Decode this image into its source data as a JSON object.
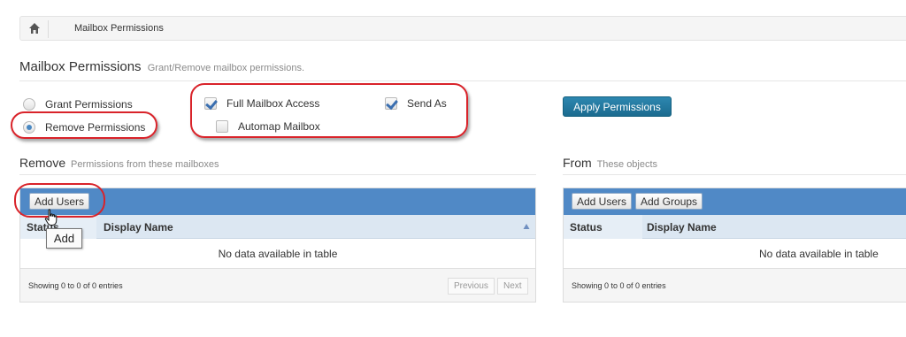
{
  "breadcrumb": {
    "current": "Mailbox Permissions"
  },
  "header": {
    "title": "Mailbox Permissions",
    "subtitle": "Grant/Remove mailbox permissions."
  },
  "options": {
    "grant_label": "Grant Permissions",
    "remove_label": "Remove Permissions",
    "selected": "Remove Permissions",
    "full_access_label": "Full Mailbox Access",
    "full_access_checked": true,
    "send_as_label": "Send As",
    "send_as_checked": true,
    "automap_label": "Automap Mailbox",
    "automap_checked": false
  },
  "apply_button": "Apply Permissions",
  "remove_section": {
    "title": "Remove",
    "subtitle": "Permissions from these mailboxes",
    "add_users": "Add Users",
    "columns": [
      "Status",
      "Display Name"
    ],
    "empty": "No data available in table",
    "info": "Showing 0 to 0 of 0 entries",
    "previous": "Previous",
    "next": "Next"
  },
  "from_section": {
    "title": "From",
    "subtitle": "These objects",
    "add_users": "Add Users",
    "add_groups": "Add Groups",
    "columns": [
      "Status",
      "Display Name"
    ],
    "empty": "No data available in table",
    "info": "Showing 0 to 0 of 0 entries"
  },
  "tooltip": "Add",
  "colors": {
    "toolbar": "#5089c6",
    "apply": "#1f7396",
    "annotation": "#d9232a"
  },
  "icons": [
    "home-icon",
    "sort-asc-icon",
    "hand-cursor-icon"
  ]
}
